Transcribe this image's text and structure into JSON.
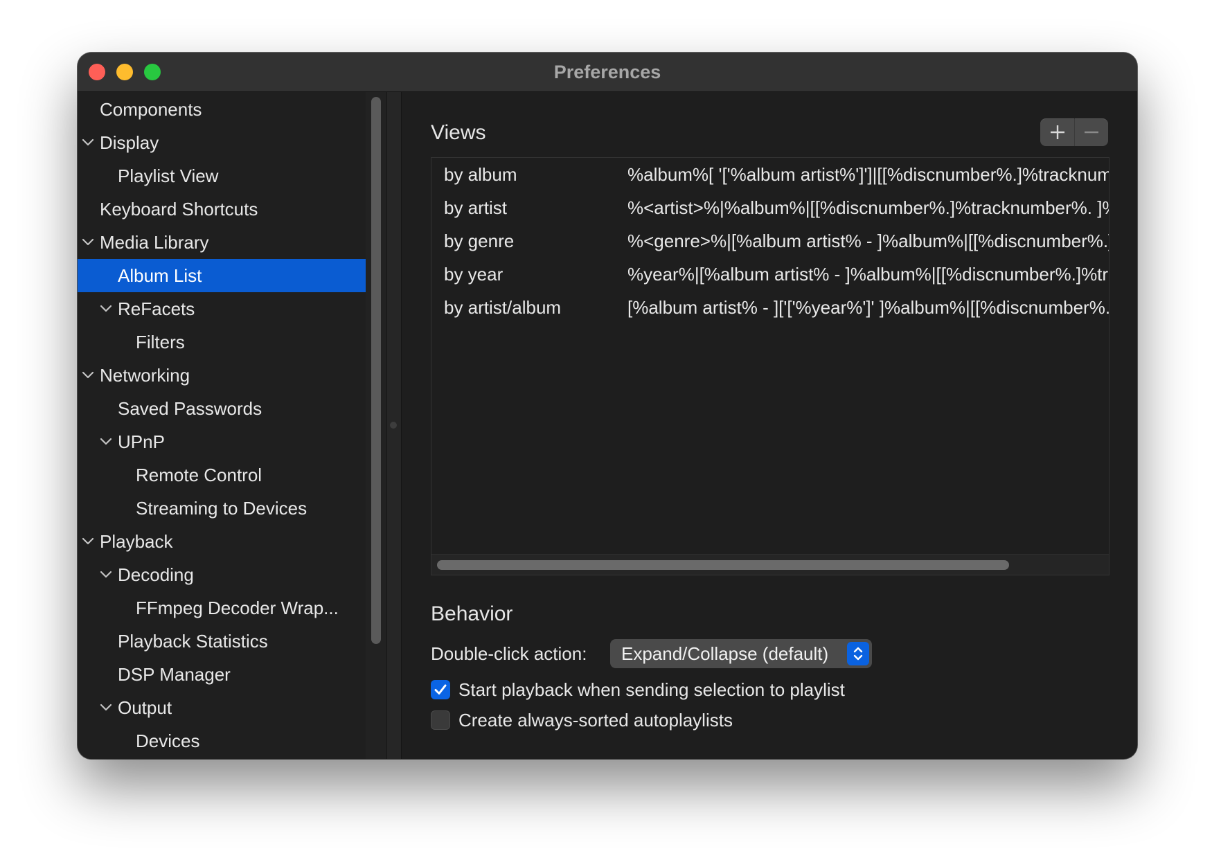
{
  "window": {
    "title": "Preferences"
  },
  "sidebar": {
    "items": [
      {
        "label": "Components",
        "level": 0,
        "expandable": false,
        "selected": false
      },
      {
        "label": "Display",
        "level": 0,
        "expandable": true,
        "selected": false
      },
      {
        "label": "Playlist View",
        "level": 1,
        "expandable": false,
        "selected": false
      },
      {
        "label": "Keyboard Shortcuts",
        "level": 0,
        "expandable": false,
        "selected": false
      },
      {
        "label": "Media Library",
        "level": 0,
        "expandable": true,
        "selected": false
      },
      {
        "label": "Album List",
        "level": 1,
        "expandable": false,
        "selected": true
      },
      {
        "label": "ReFacets",
        "level": 1,
        "expandable": true,
        "selected": false
      },
      {
        "label": "Filters",
        "level": 2,
        "expandable": false,
        "selected": false
      },
      {
        "label": "Networking",
        "level": 0,
        "expandable": true,
        "selected": false
      },
      {
        "label": "Saved Passwords",
        "level": 1,
        "expandable": false,
        "selected": false
      },
      {
        "label": "UPnP",
        "level": 1,
        "expandable": true,
        "selected": false
      },
      {
        "label": "Remote Control",
        "level": 2,
        "expandable": false,
        "selected": false
      },
      {
        "label": "Streaming to Devices",
        "level": 2,
        "expandable": false,
        "selected": false
      },
      {
        "label": "Playback",
        "level": 0,
        "expandable": true,
        "selected": false
      },
      {
        "label": "Decoding",
        "level": 1,
        "expandable": true,
        "selected": false
      },
      {
        "label": "FFmpeg Decoder Wrap...",
        "level": 2,
        "expandable": false,
        "selected": false
      },
      {
        "label": "Playback Statistics",
        "level": 1,
        "expandable": false,
        "selected": false
      },
      {
        "label": "DSP Manager",
        "level": 1,
        "expandable": false,
        "selected": false
      },
      {
        "label": "Output",
        "level": 1,
        "expandable": true,
        "selected": false
      },
      {
        "label": "Devices",
        "level": 2,
        "expandable": false,
        "selected": false
      }
    ]
  },
  "views": {
    "title": "Views",
    "add_icon": "plus-icon",
    "remove_icon": "minus-icon",
    "rows": [
      {
        "name": "by album",
        "pattern": "%album%[ '['%album artist%']']|[[%discnumber%.]%tracknumber%. ]%title%"
      },
      {
        "name": "by artist",
        "pattern": "%<artist>%|%album%|[[%discnumber%.]%tracknumber%. ]%title%"
      },
      {
        "name": "by genre",
        "pattern": "%<genre>%|[%album artist% - ]%album%|[[%discnumber%.]%tracknumber%. ]%title%"
      },
      {
        "name": "by year",
        "pattern": "%year%|[%album artist% - ]%album%|[[%discnumber%.]%tracknumber%. ]%title%"
      },
      {
        "name": "by artist/album",
        "pattern": "[%album artist% - ]['['%year%']' ]%album%|[[%discnumber%.]%tracknumber%. ]%title%"
      }
    ]
  },
  "behavior": {
    "title": "Behavior",
    "double_click_label": "Double-click action:",
    "double_click_value": "Expand/Collapse (default)",
    "checkboxes": [
      {
        "label": "Start playback when sending selection to playlist",
        "checked": true
      },
      {
        "label": "Create always-sorted autoplaylists",
        "checked": false
      }
    ]
  },
  "colors": {
    "accent": "#0a5cd2",
    "window_bg": "#1e1e1e",
    "close": "#fe5f57",
    "minimize": "#febc2e",
    "maximize": "#28c840"
  }
}
